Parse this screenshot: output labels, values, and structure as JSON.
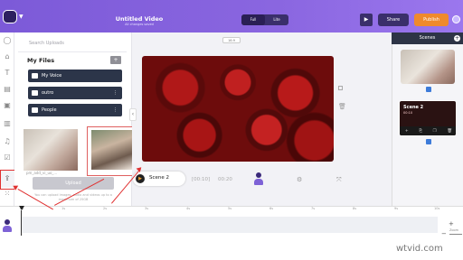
{
  "app": {
    "title": "Untitled Video",
    "subtitle": "All changes saved",
    "ratio_options": [
      "Full",
      "Lite"
    ],
    "play_icon": "▶",
    "share_label": "Share",
    "publish_label": "Publish",
    "colors": {
      "header": "#7c5ad8",
      "publish": "#ef8a2c",
      "dark": "#2c3549"
    }
  },
  "sidebar": {
    "icons": [
      "user-icon",
      "home-icon",
      "text-icon",
      "layout-icon",
      "image-icon",
      "chart-icon",
      "music-icon",
      "check-icon",
      "upload-icon",
      "grid-icon"
    ]
  },
  "uploads": {
    "search_placeholder": "Search Uploads",
    "section_title": "My Files",
    "folders": [
      {
        "label": "My Voice",
        "dots": ""
      },
      {
        "label": "outro",
        "dots": "⋮"
      },
      {
        "label": "People",
        "dots": "⋮"
      }
    ],
    "thumb1_caption": "",
    "thumb2_caption": "",
    "file1_name": "pm_add_vi_uo_...",
    "file2_name": "",
    "upload_label": "Upload",
    "upload_note": "You can upload images, audio and videos up to a maximum of 25GB"
  },
  "canvas": {
    "size_chip": "16:9",
    "collapse_glyph": "‹"
  },
  "scene_bar": {
    "scene_label": "Scene 2",
    "play_glyph": "▶",
    "time_current": "[00:10]",
    "time_total": "00:20"
  },
  "scenes_panel": {
    "title": "Scenes",
    "add_glyph": "+",
    "scene1_caption": "",
    "scene2_title": "Scene 2",
    "scene2_duration": "00:10",
    "scene2_tools": [
      "+",
      "⎘",
      "❐",
      "🗑"
    ]
  },
  "timeline": {
    "ticks": [
      "0s",
      "1s",
      "2s",
      "3s",
      "4s",
      "5s",
      "6s",
      "7s",
      "8s",
      "9s",
      "10s"
    ],
    "zoom_label": "Zoom"
  },
  "watermark": "wtvid.com"
}
